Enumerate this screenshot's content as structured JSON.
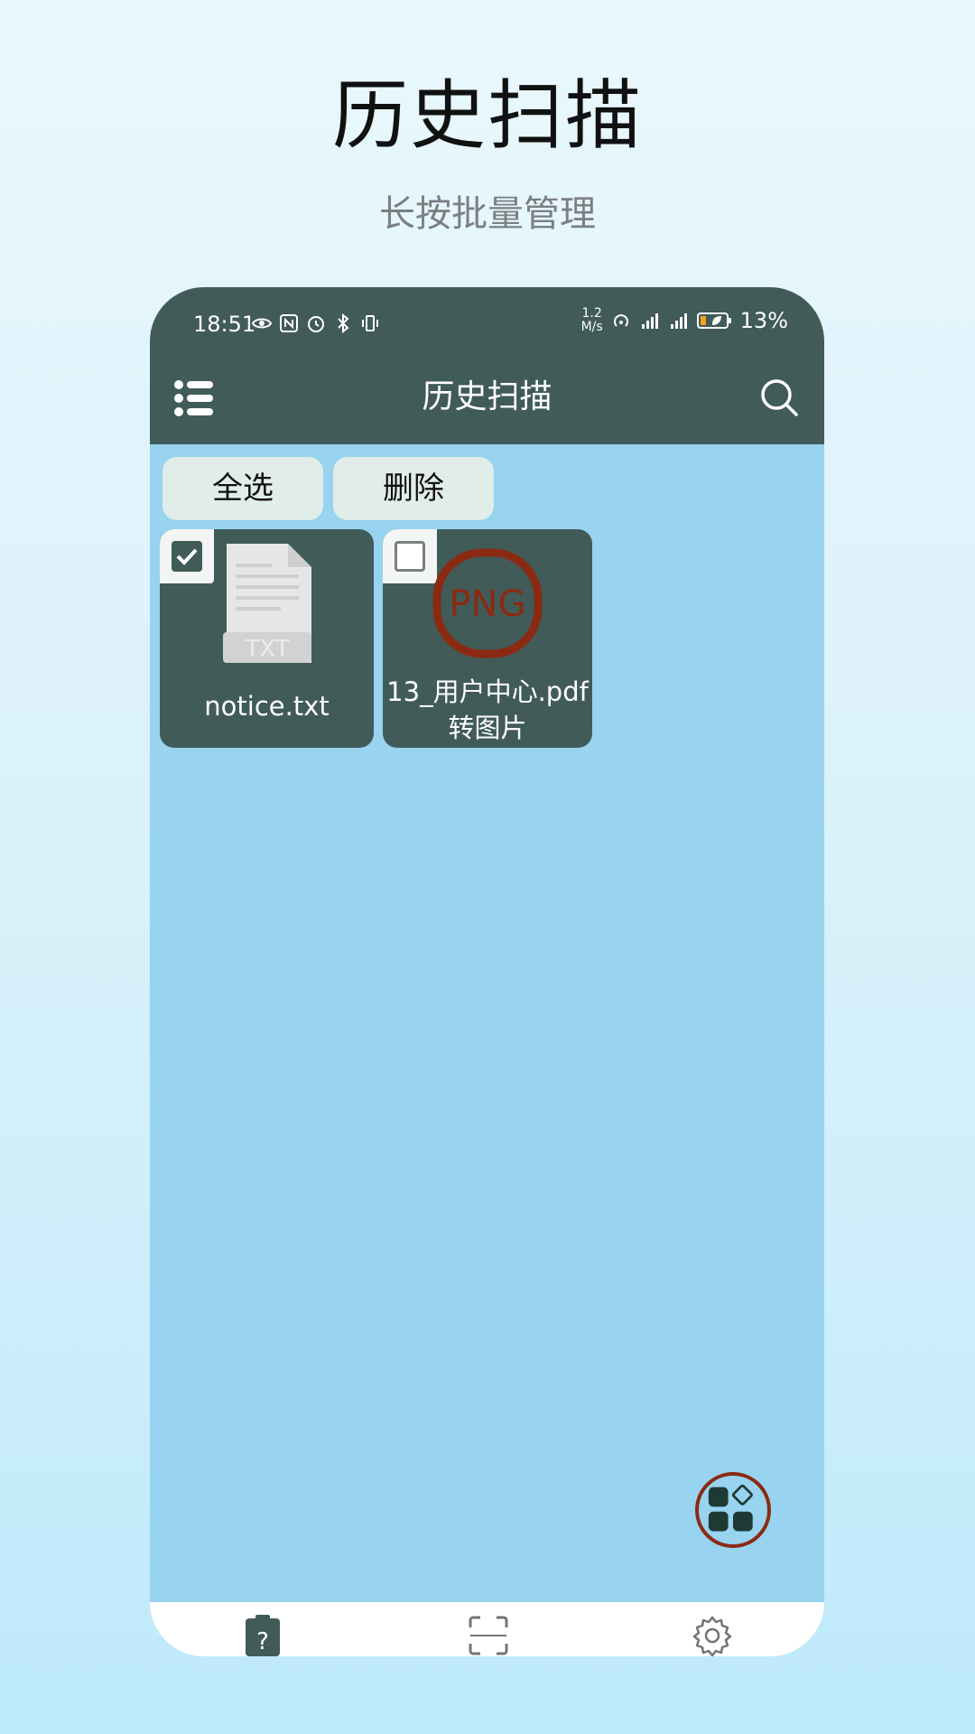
{
  "header": {
    "title": "历史扫描",
    "subtitle": "长按批量管理"
  },
  "status_bar": {
    "time": "18:51",
    "speed_value": "1.2",
    "speed_unit": "M/s",
    "battery": "13%",
    "left_icons": [
      "eye-icon",
      "nfc-icon",
      "alarm-icon",
      "bluetooth-icon",
      "vibrate-icon"
    ],
    "right_icons": [
      "hotspot-icon",
      "signal-5g-icon",
      "signal-5g-icon",
      "battery-icon"
    ]
  },
  "appbar": {
    "title": "历史扫描",
    "menu_icon": "list-menu-icon",
    "search_icon": "search-icon"
  },
  "actions": {
    "select_all": "全选",
    "delete": "删除"
  },
  "files": [
    {
      "name": "notice.txt",
      "type": "TXT",
      "checked": true
    },
    {
      "name": "13_用户中心.pdf转图片",
      "type": "PNG",
      "checked": false
    }
  ],
  "fab": {
    "icon": "apps-grid-icon"
  },
  "bottom_nav": {
    "items": [
      "history-clipboard-icon",
      "scan-frame-icon",
      "settings-gear-icon"
    ]
  },
  "colors": {
    "toolbar": "#415b58",
    "content_bg": "#98d3ef",
    "chip_bg": "#e1ede8",
    "accent_red": "#8b2a12"
  }
}
